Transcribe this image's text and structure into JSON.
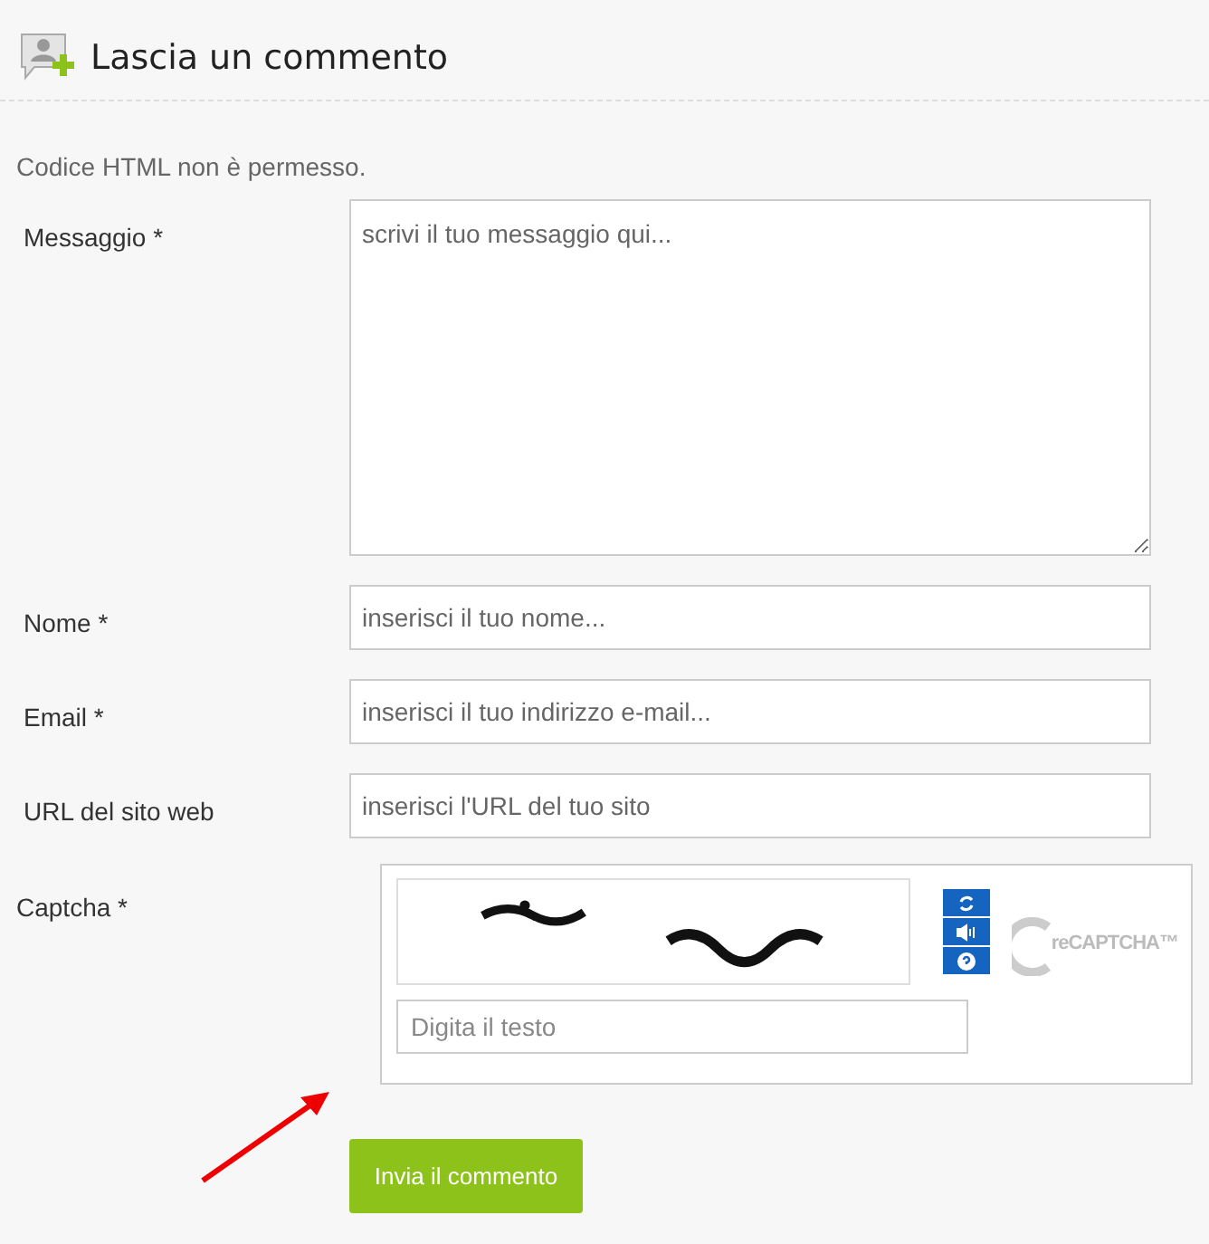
{
  "header": {
    "title": "Lascia un commento"
  },
  "note": "Codice HTML non è permesso.",
  "fields": [
    {
      "kind": "textarea",
      "label": "Messaggio *",
      "placeholder": "scrivi il tuo messaggio qui..."
    },
    {
      "kind": "input",
      "label": "Nome *",
      "placeholder": "inserisci il tuo nome..."
    },
    {
      "kind": "input",
      "label": "Email *",
      "placeholder": "inserisci il tuo indirizzo e-mail..."
    },
    {
      "kind": "input",
      "label": "URL del sito web",
      "placeholder": "inserisci l'URL del tuo sito"
    }
  ],
  "captcha": {
    "label": "Captcha *",
    "placeholder": "Digita il testo",
    "logo": "reCAPTCHA™"
  },
  "submit": "Invia il commento"
}
